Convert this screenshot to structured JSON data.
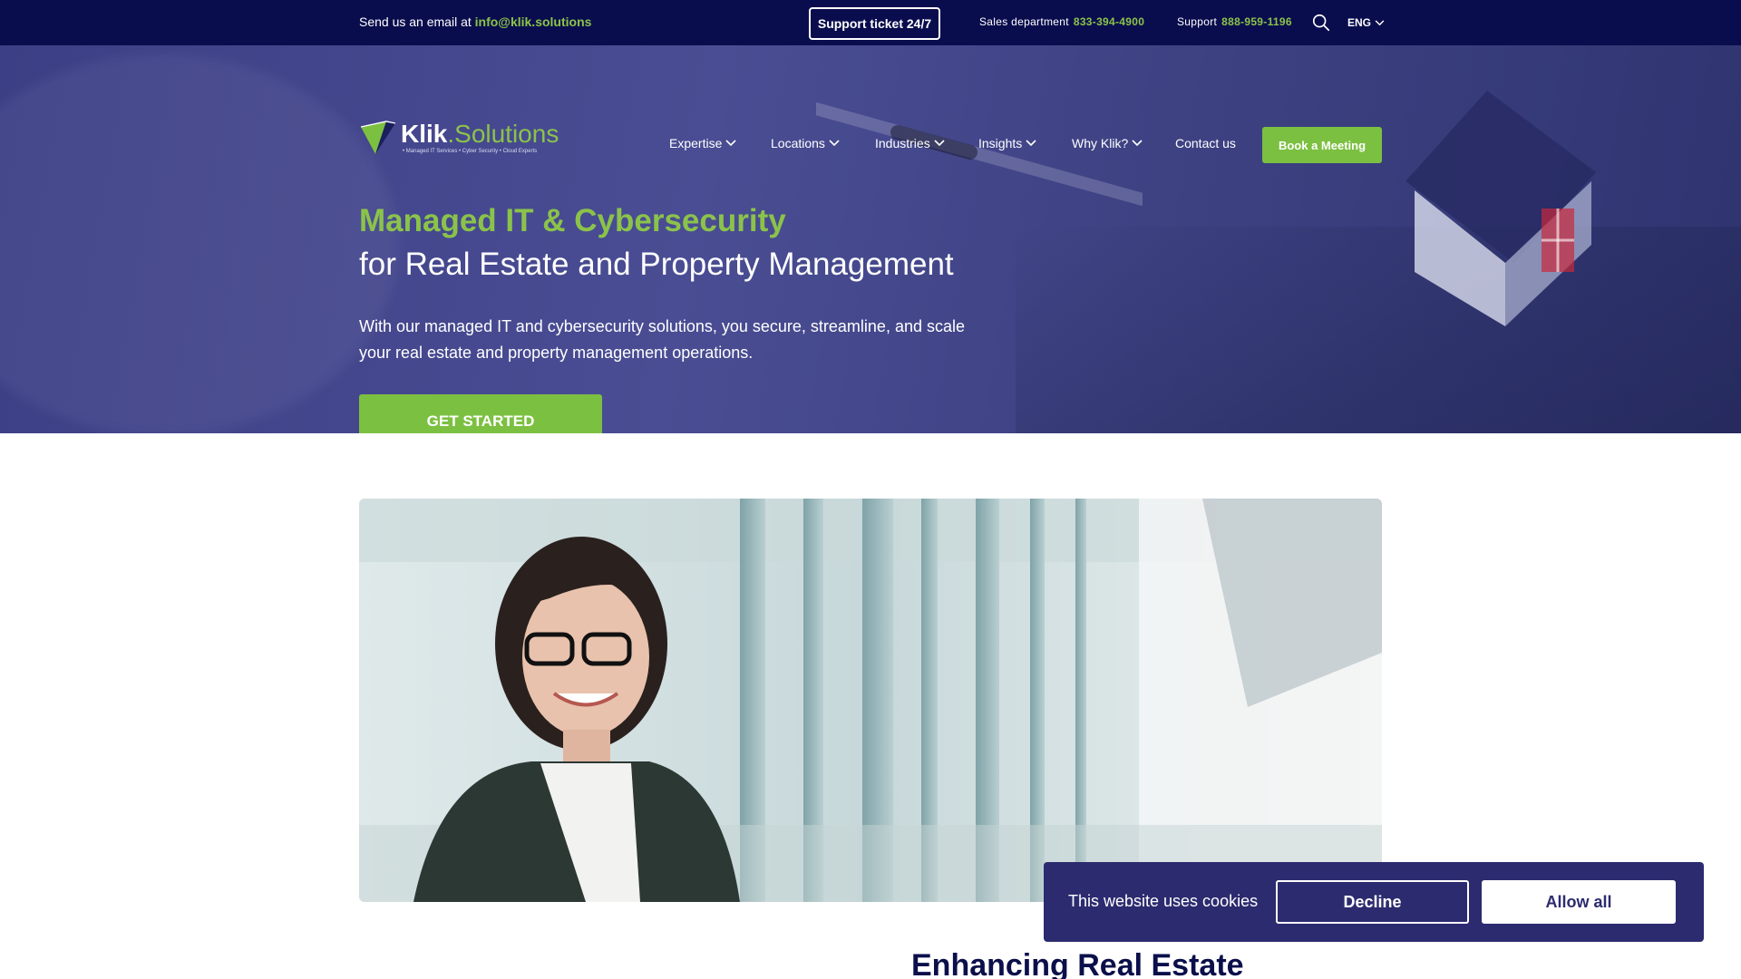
{
  "topbar": {
    "email_prefix": "Send us an email at",
    "email": "info@klik.solutions",
    "support_ticket": "Support ticket 24/7",
    "sales_label": "Sales department",
    "sales_number": "833-394-4900",
    "support_label": "Support",
    "support_number": "888-959-1196",
    "search_icon": "search-icon",
    "language": "ENG"
  },
  "brand": {
    "name_part1": "Klik",
    "name_part2": ".Solutions",
    "tagline": "• Managed IT Services • Cyber Security • Cloud Experts"
  },
  "nav": {
    "items": [
      {
        "label": "Expertise",
        "has_dropdown": true
      },
      {
        "label": "Locations",
        "has_dropdown": true
      },
      {
        "label": "Industries",
        "has_dropdown": true
      },
      {
        "label": "Insights",
        "has_dropdown": true
      },
      {
        "label": "Why Klik?",
        "has_dropdown": true
      },
      {
        "label": "Contact us",
        "has_dropdown": false
      }
    ],
    "cta": "Book a Meeting"
  },
  "hero": {
    "title_line1": "Managed IT & Cybersecurity",
    "title_line2": "for Real Estate and Property Management",
    "body": "With our managed IT and cybersecurity solutions, you secure, streamline, and scale your real estate and property management operations.",
    "cta": "GET STARTED"
  },
  "section": {
    "heading": "Enhancing Real Estate"
  },
  "cookie_banner": {
    "message": "This website uses cookies",
    "decline": "Decline",
    "allow": "Allow all"
  },
  "colors": {
    "navy": "#0a0d4d",
    "green": "#7cc041",
    "banner": "#2c2b6f"
  }
}
